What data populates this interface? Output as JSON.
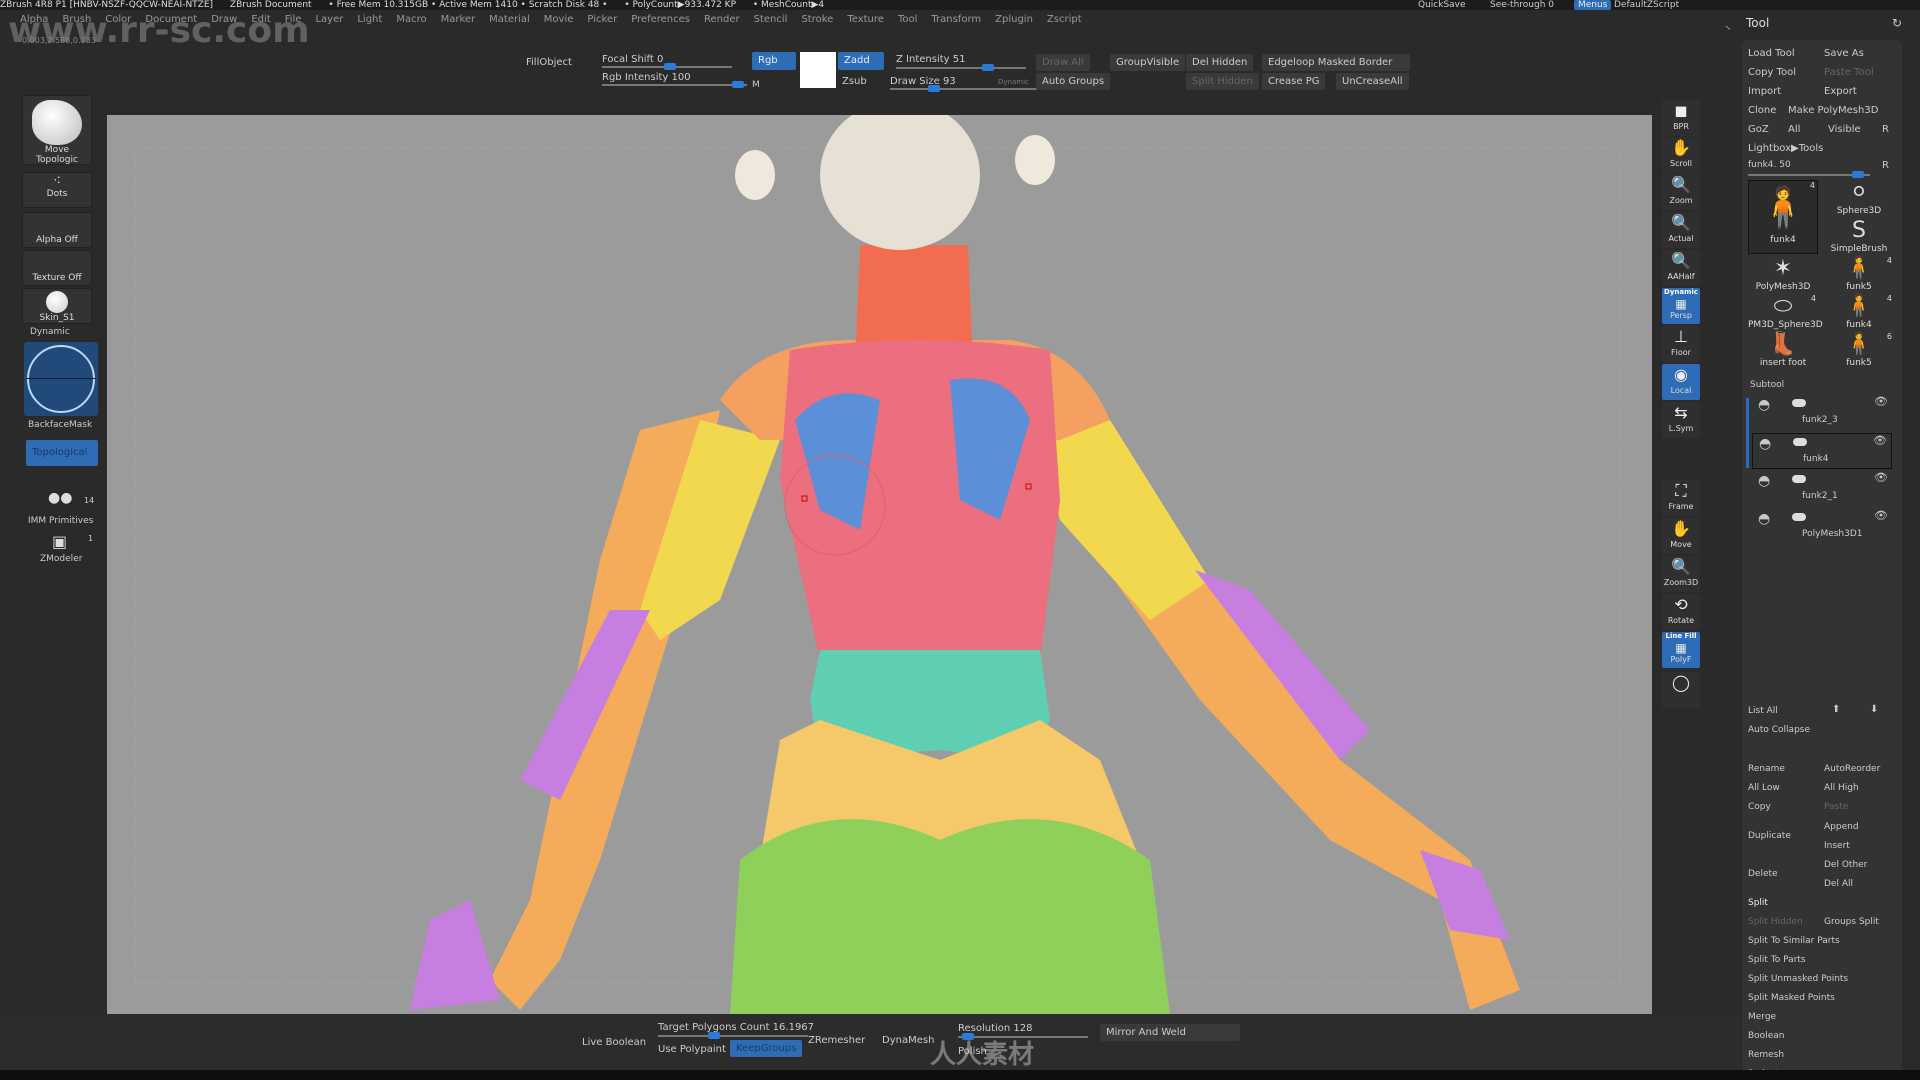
{
  "titlebar": {
    "items": [
      "ZBrush 4R8 P1 [HNBV-NSZF-QQCW-NEAI-NTZE]",
      "ZBrush Document",
      "• Free Mem 10.315GB • Active Mem 1410 • Scratch Disk 48 •",
      "• PolyCount▶933.472 KP",
      "• MeshCount▶4"
    ],
    "quicksave": "QuickSave",
    "seethrough": "See-through  0",
    "menus": "Menus",
    "script": "DefaultZScript"
  },
  "menubar": [
    "Alpha",
    "Brush",
    "Color",
    "Document",
    "Draw",
    "Edit",
    "File",
    "Layer",
    "Light",
    "Macro",
    "Marker",
    "Material",
    "Movie",
    "Picker",
    "Preferences",
    "Render",
    "Stencil",
    "Stroke",
    "Texture",
    "Tool",
    "Transform",
    "Zplugin",
    "Zscript"
  ],
  "watermark": "www.rr-sc.com",
  "coords": "0.003,2.588,0.133",
  "topbar": {
    "fillobject": "FillObject",
    "focal_shift": "Focal Shift 0",
    "rgb_intensity": "Rgb Intensity 100",
    "rgb": "Rgb",
    "m": "M",
    "zadd": "Zadd",
    "zsub": "Zsub",
    "z_intensity": "Z Intensity 51",
    "draw_size": "Draw Size 93",
    "dynamic": "Dynamic",
    "draw_all": "Draw All",
    "auto_groups": "Auto Groups",
    "group_visible": "GroupVisible",
    "del_hidden": "Del Hidden",
    "edgeloop": "Edgeloop Masked Border",
    "split_hidden": "Split Hidden",
    "crease_pg": "Crease PG",
    "uncrease_all": "UnCreaseAll",
    "focal_shift_value": 0,
    "rgb_intensity_value": 100,
    "z_intensity_value": 51,
    "draw_size_value": 93
  },
  "shelf": {
    "brush": "Move Topologic",
    "stroke": "Dots",
    "alpha": "Alpha Off",
    "texture": "Texture Off",
    "material": "Skin_S1",
    "dynamic": "Dynamic",
    "backface": "BackfaceMask",
    "topological": "Topological",
    "imm": "IMM Primitives",
    "imm_count": "14",
    "zmodeler": "ZModeler",
    "zmodeler_count": "1"
  },
  "righttools": [
    {
      "label": "BPR",
      "icon": "bpr-icon"
    },
    {
      "label": "Scroll",
      "icon": "scroll-icon"
    },
    {
      "label": "Zoom",
      "icon": "zoom-icon"
    },
    {
      "label": "Actual",
      "icon": "actual-icon"
    },
    {
      "label": "AAHalf",
      "icon": "aahalf-icon"
    },
    {
      "label": "Persp",
      "icon": "persp-icon",
      "active": true
    },
    {
      "label": "Floor",
      "icon": "floor-icon"
    },
    {
      "label": "Local",
      "icon": "local-icon",
      "active": true
    },
    {
      "label": "L.Sym",
      "icon": "lsym-icon"
    },
    {
      "label": "Frame",
      "icon": "frame-icon"
    },
    {
      "label": "Move",
      "icon": "move-icon"
    },
    {
      "label": "Zoom3D",
      "icon": "zoom3d-icon"
    },
    {
      "label": "Rotate",
      "icon": "rotate-icon"
    },
    {
      "label": "PolyF",
      "icon": "polyf-icon",
      "active": true
    },
    {
      "label": "",
      "icon": "transp-icon"
    }
  ],
  "persp_top": "Dynamic",
  "polyf_top": "Line Fill",
  "tool": {
    "title": "Tool",
    "buttons": [
      [
        "Load Tool",
        "Save As"
      ],
      [
        "Copy Tool",
        "Paste Tool"
      ],
      [
        "Import",
        "Export"
      ],
      [
        "Clone",
        "Make PolyMesh3D"
      ],
      [
        "GoZ",
        "All",
        "Visible",
        "R"
      ]
    ],
    "lightbox": "Lightbox▶Tools",
    "slider": "funk4. 50",
    "slider_r": "R",
    "slider_value": 50,
    "thumbs": [
      {
        "name": "funk4",
        "count": "4"
      },
      {
        "name": "Sphere3D",
        "count": ""
      },
      {
        "name": "SimpleBrush",
        "count": ""
      },
      {
        "name": "PolyMesh3D",
        "count": ""
      },
      {
        "name": "funk5",
        "count": "4"
      },
      {
        "name": "PM3D_Sphere3D",
        "count": "4"
      },
      {
        "name": "funk4",
        "count": "4"
      },
      {
        "name": "insert foot",
        "count": ""
      },
      {
        "name": "funk5",
        "count": "6"
      }
    ],
    "subtool_title": "Subtool",
    "subtools": [
      "funk2_3",
      "funk4",
      "funk2_1",
      "PolyMesh3D1"
    ],
    "list_all": "List All",
    "auto_collapse": "Auto Collapse",
    "ops": [
      [
        "Rename",
        "AutoReorder"
      ],
      [
        "All Low",
        "All High"
      ],
      [
        "Copy",
        "Paste"
      ]
    ],
    "duplicate": "Duplicate",
    "append": "Append",
    "insert": "Insert",
    "delete": "Delete",
    "del_other": "Del Other",
    "del_all": "Del All",
    "split": "Split",
    "split_hidden": "Split Hidden",
    "groups_split": "Groups Split",
    "split_items": [
      "Split To Similar Parts",
      "Split To Parts",
      "Split Unmasked Points",
      "Split Masked Points"
    ],
    "more": [
      "Merge",
      "Boolean",
      "Remesh",
      "Project"
    ]
  },
  "bottom": {
    "live_boolean": "Live Boolean",
    "target": "Target Polygons Count 16.1967",
    "use_polypaint": "Use Polypaint",
    "keepgroups": "KeepGroups",
    "zremesher": "ZRemesher",
    "dynamesh": "DynaMesh",
    "resolution": "Resolution 128",
    "polish": "Polish",
    "mirror": "Mirror And Weld",
    "resolution_value": 128,
    "logo_text": "人人素材"
  },
  "colors": {
    "viewport": "#9b9b9b",
    "accent": "#2e6cb5",
    "skin": "#e7e0d4",
    "neck": "#f26d4f",
    "torso": "#ec6f80",
    "blade": "#5b8fd8",
    "waist": "#5fcfb3",
    "hips": "#f5c86a",
    "butt": "#8ed05a",
    "arm": "#f2d84f",
    "forearm": "#f4ab5a",
    "purple": "#c67fe0"
  }
}
